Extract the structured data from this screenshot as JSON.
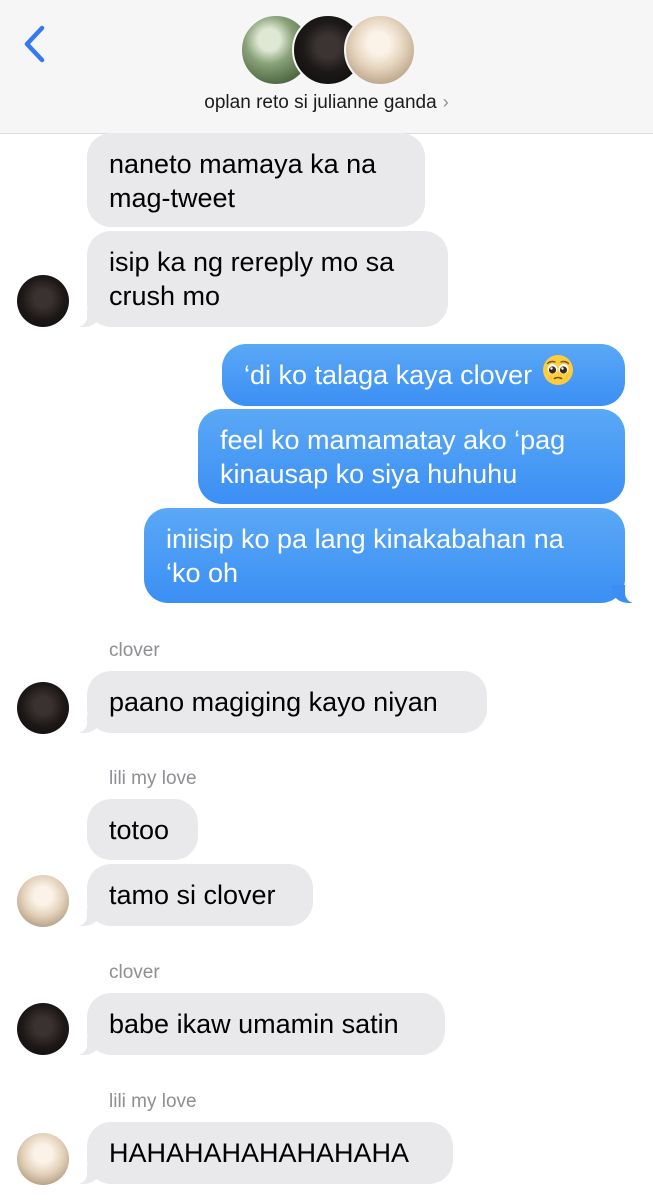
{
  "header": {
    "group_name": "oplan reto si julianne ganda",
    "chevron": "›",
    "back_icon": "chevron-left-icon"
  },
  "colors": {
    "incoming_bubble": "#e9e9eb",
    "outgoing_bubble": "#3b8ff4",
    "back_accent": "#3478f6",
    "sender_gray": "#8e8e93"
  },
  "messages": [
    {
      "direction": "in",
      "lines": [
        "naneto mamaya ka na",
        "mag-tweet"
      ]
    },
    {
      "direction": "in",
      "lines": [
        "isip ka ng rereply mo sa",
        "crush mo"
      ],
      "avatar": "clover"
    },
    {
      "direction": "out",
      "lines": [
        "‘di ko talaga kaya clover"
      ],
      "emoji": "pleading-face-emoji"
    },
    {
      "direction": "out",
      "lines": [
        "feel ko mamamatay ako ‘pag",
        "kinausap ko siya huhuhu"
      ]
    },
    {
      "direction": "out",
      "lines": [
        "iniisip ko pa lang kinakabahan na",
        "‘ko oh"
      ]
    },
    {
      "sender": "clover"
    },
    {
      "direction": "in",
      "lines": [
        "paano magiging kayo niyan"
      ],
      "avatar": "clover"
    },
    {
      "sender": "lili my love"
    },
    {
      "direction": "in",
      "lines": [
        "totoo"
      ]
    },
    {
      "direction": "in",
      "lines": [
        "tamo si clover"
      ],
      "avatar": "lili"
    },
    {
      "sender": "clover"
    },
    {
      "direction": "in",
      "lines": [
        "babe ikaw umamin satin"
      ],
      "avatar": "clover"
    },
    {
      "sender": "lili my love"
    },
    {
      "direction": "in",
      "lines": [
        "HAHAHAHAHAHAHAHA"
      ],
      "avatar": "lili"
    }
  ]
}
